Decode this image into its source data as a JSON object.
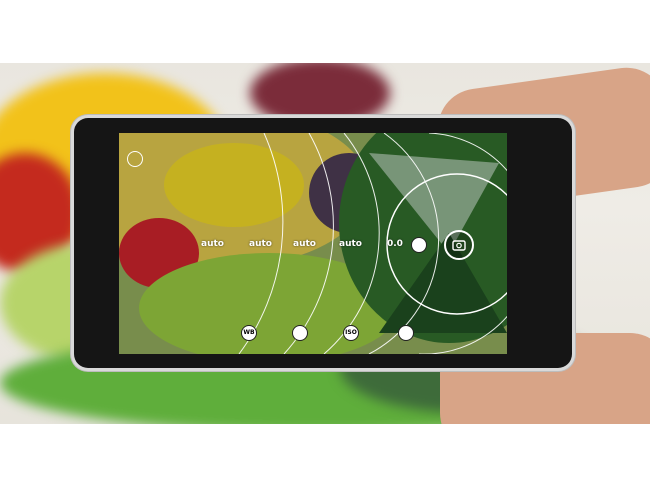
{
  "camera": {
    "dials": {
      "white_balance_value": "auto",
      "focus_value": "auto",
      "iso_value": "auto",
      "shutter_speed_value": "auto",
      "exposure_value": "0.0"
    },
    "controls": {
      "wb_label": "WB",
      "iso_label": "ISO"
    },
    "icons": [
      "settings-icon",
      "focus-icon",
      "exposure-icon",
      "camera-icon",
      "shutter-speed-icon"
    ]
  }
}
